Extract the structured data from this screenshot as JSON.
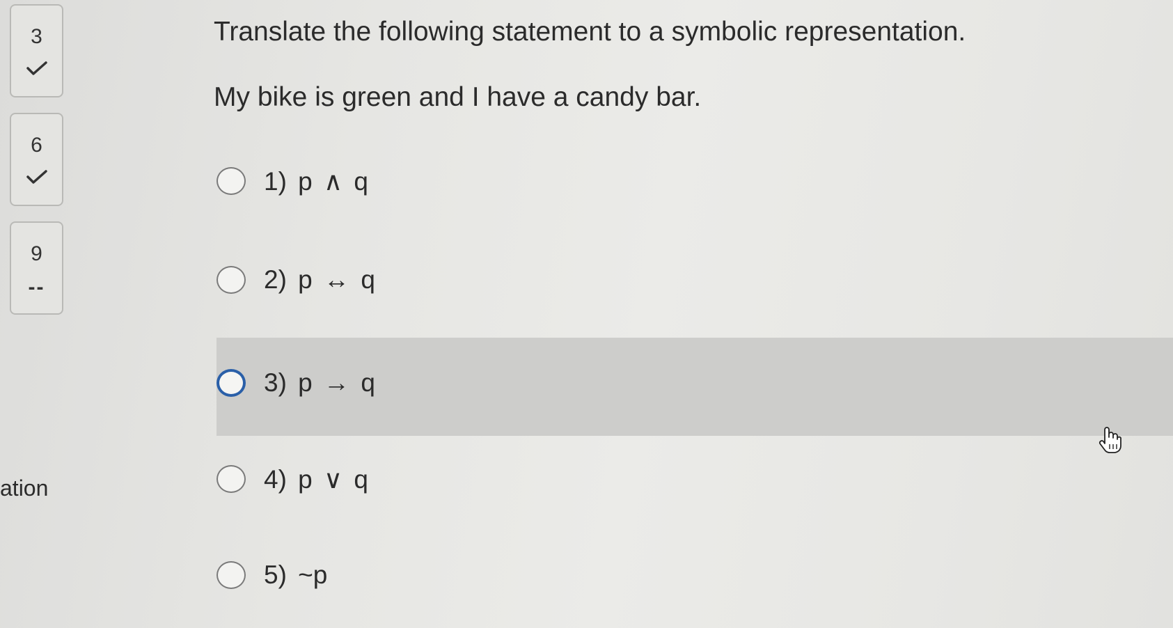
{
  "nav": {
    "items": [
      {
        "number": "3",
        "status": "answered",
        "status_icon": "check-icon"
      },
      {
        "number": "6",
        "status": "answered",
        "status_icon": "check-icon"
      },
      {
        "number": "9",
        "status_text": "--",
        "status": "unanswered"
      }
    ]
  },
  "side_fragment": "ation",
  "question": {
    "prompt": "Translate the following statement to a symbolic representation.",
    "statement": "My bike is green and I have a candy bar."
  },
  "options": [
    {
      "label": "1) p ∧ q",
      "selected": false
    },
    {
      "label": "2) p ↔ q",
      "selected": false
    },
    {
      "label": "3) p → q",
      "selected": false,
      "highlighted": true
    },
    {
      "label": "4) p ∨ q",
      "selected": false
    },
    {
      "label": "5) ~p",
      "selected": false
    }
  ],
  "colors": {
    "focus_ring": "#2a5fa8",
    "highlight_band": "#cdcdcb"
  },
  "cursor": {
    "icon": "hand-pointer-icon"
  }
}
